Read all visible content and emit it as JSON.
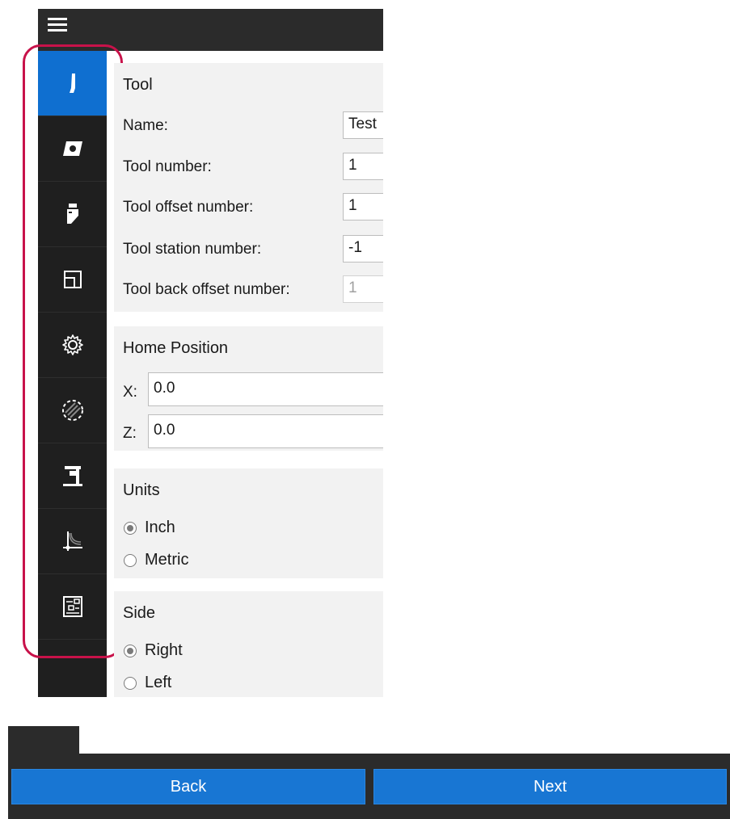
{
  "sidebar": {
    "items": [
      {
        "icon": "tool-icon",
        "active": true
      },
      {
        "icon": "insert-icon",
        "active": false
      },
      {
        "icon": "holder-icon",
        "active": false
      },
      {
        "icon": "layout-icon",
        "active": false
      },
      {
        "icon": "gear-icon",
        "active": false
      },
      {
        "icon": "stock-circle-icon",
        "active": false
      },
      {
        "icon": "machine-icon",
        "active": false
      },
      {
        "icon": "profile-curve-icon",
        "active": false
      },
      {
        "icon": "panel-controls-icon",
        "active": false
      }
    ],
    "accent_color": "#0f6fd0",
    "highlight_color": "#c8124a"
  },
  "tool": {
    "title": "Tool",
    "name_label": "Name:",
    "name_value": "Test",
    "number_label": "Tool number:",
    "number_value": "1",
    "offset_label": "Tool offset number:",
    "offset_value": "1",
    "station_label": "Tool station number:",
    "station_value": "-1",
    "back_offset_label": "Tool back offset number:",
    "back_offset_value": "1"
  },
  "home": {
    "title": "Home Position",
    "x_label": "X:",
    "x_value": "0.0",
    "z_label": "Z:",
    "z_value": "0.0"
  },
  "units": {
    "title": "Units",
    "options": [
      {
        "label": "Inch",
        "checked": true
      },
      {
        "label": "Metric",
        "checked": false
      }
    ]
  },
  "side": {
    "title": "Side",
    "options": [
      {
        "label": "Right",
        "checked": true
      },
      {
        "label": "Left",
        "checked": false
      }
    ]
  },
  "footer": {
    "back_label": "Back",
    "next_label": "Next",
    "button_color": "#1876d3"
  }
}
